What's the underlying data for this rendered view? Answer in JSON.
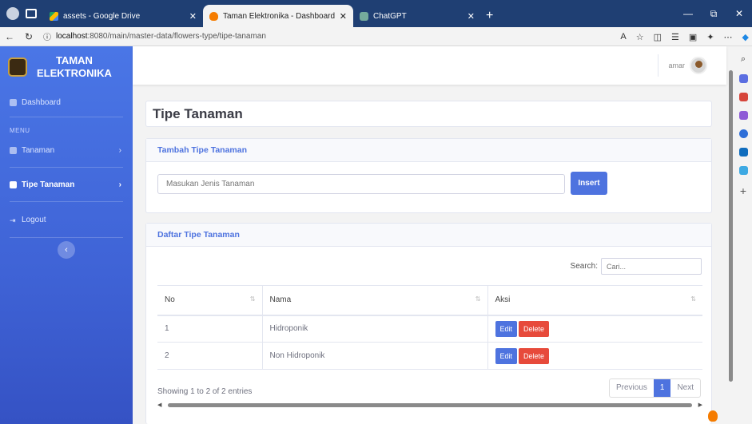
{
  "browser": {
    "tabs": [
      {
        "title": "assets - Google Drive",
        "favicon": "drive-icon"
      },
      {
        "title": "Taman Elektronika - Dashboard",
        "favicon": "fire-icon"
      },
      {
        "title": "ChatGPT",
        "favicon": "chatgpt-icon"
      }
    ],
    "url_host": "localhost",
    "url_path": ":8080/main/master-data/flowers-type/tipe-tanaman"
  },
  "sidebar": {
    "brand_line1": "TAMAN",
    "brand_line2": "ELEKTRONIKA",
    "dashboard": "Dashboard",
    "menu_heading": "MENU",
    "tanaman": "Tanaman",
    "tipe_tanaman": "Tipe Tanaman",
    "logout": "Logout"
  },
  "topbar": {
    "username": "amar"
  },
  "page": {
    "title": "Tipe Tanaman"
  },
  "add_card": {
    "header": "Tambah Tipe Tanaman",
    "input_placeholder": "Masukan Jenis Tanaman",
    "insert_label": "Insert"
  },
  "list_card": {
    "header": "Daftar Tipe Tanaman",
    "search_label": "Search:",
    "search_placeholder": "Cari...",
    "columns": [
      "No",
      "Nama",
      "Aksi"
    ],
    "rows": [
      {
        "no": "1",
        "nama": "Hidroponik"
      },
      {
        "no": "2",
        "nama": "Non Hidroponik"
      }
    ],
    "edit_label": "Edit",
    "delete_label": "Delete",
    "info": "Showing 1 to 2 of 2 entries",
    "pager": {
      "previous": "Previous",
      "current": "1",
      "next": "Next"
    }
  },
  "colors": {
    "primary": "#4e73df",
    "danger": "#e74a3b",
    "sidebar": "#4a76e6"
  }
}
